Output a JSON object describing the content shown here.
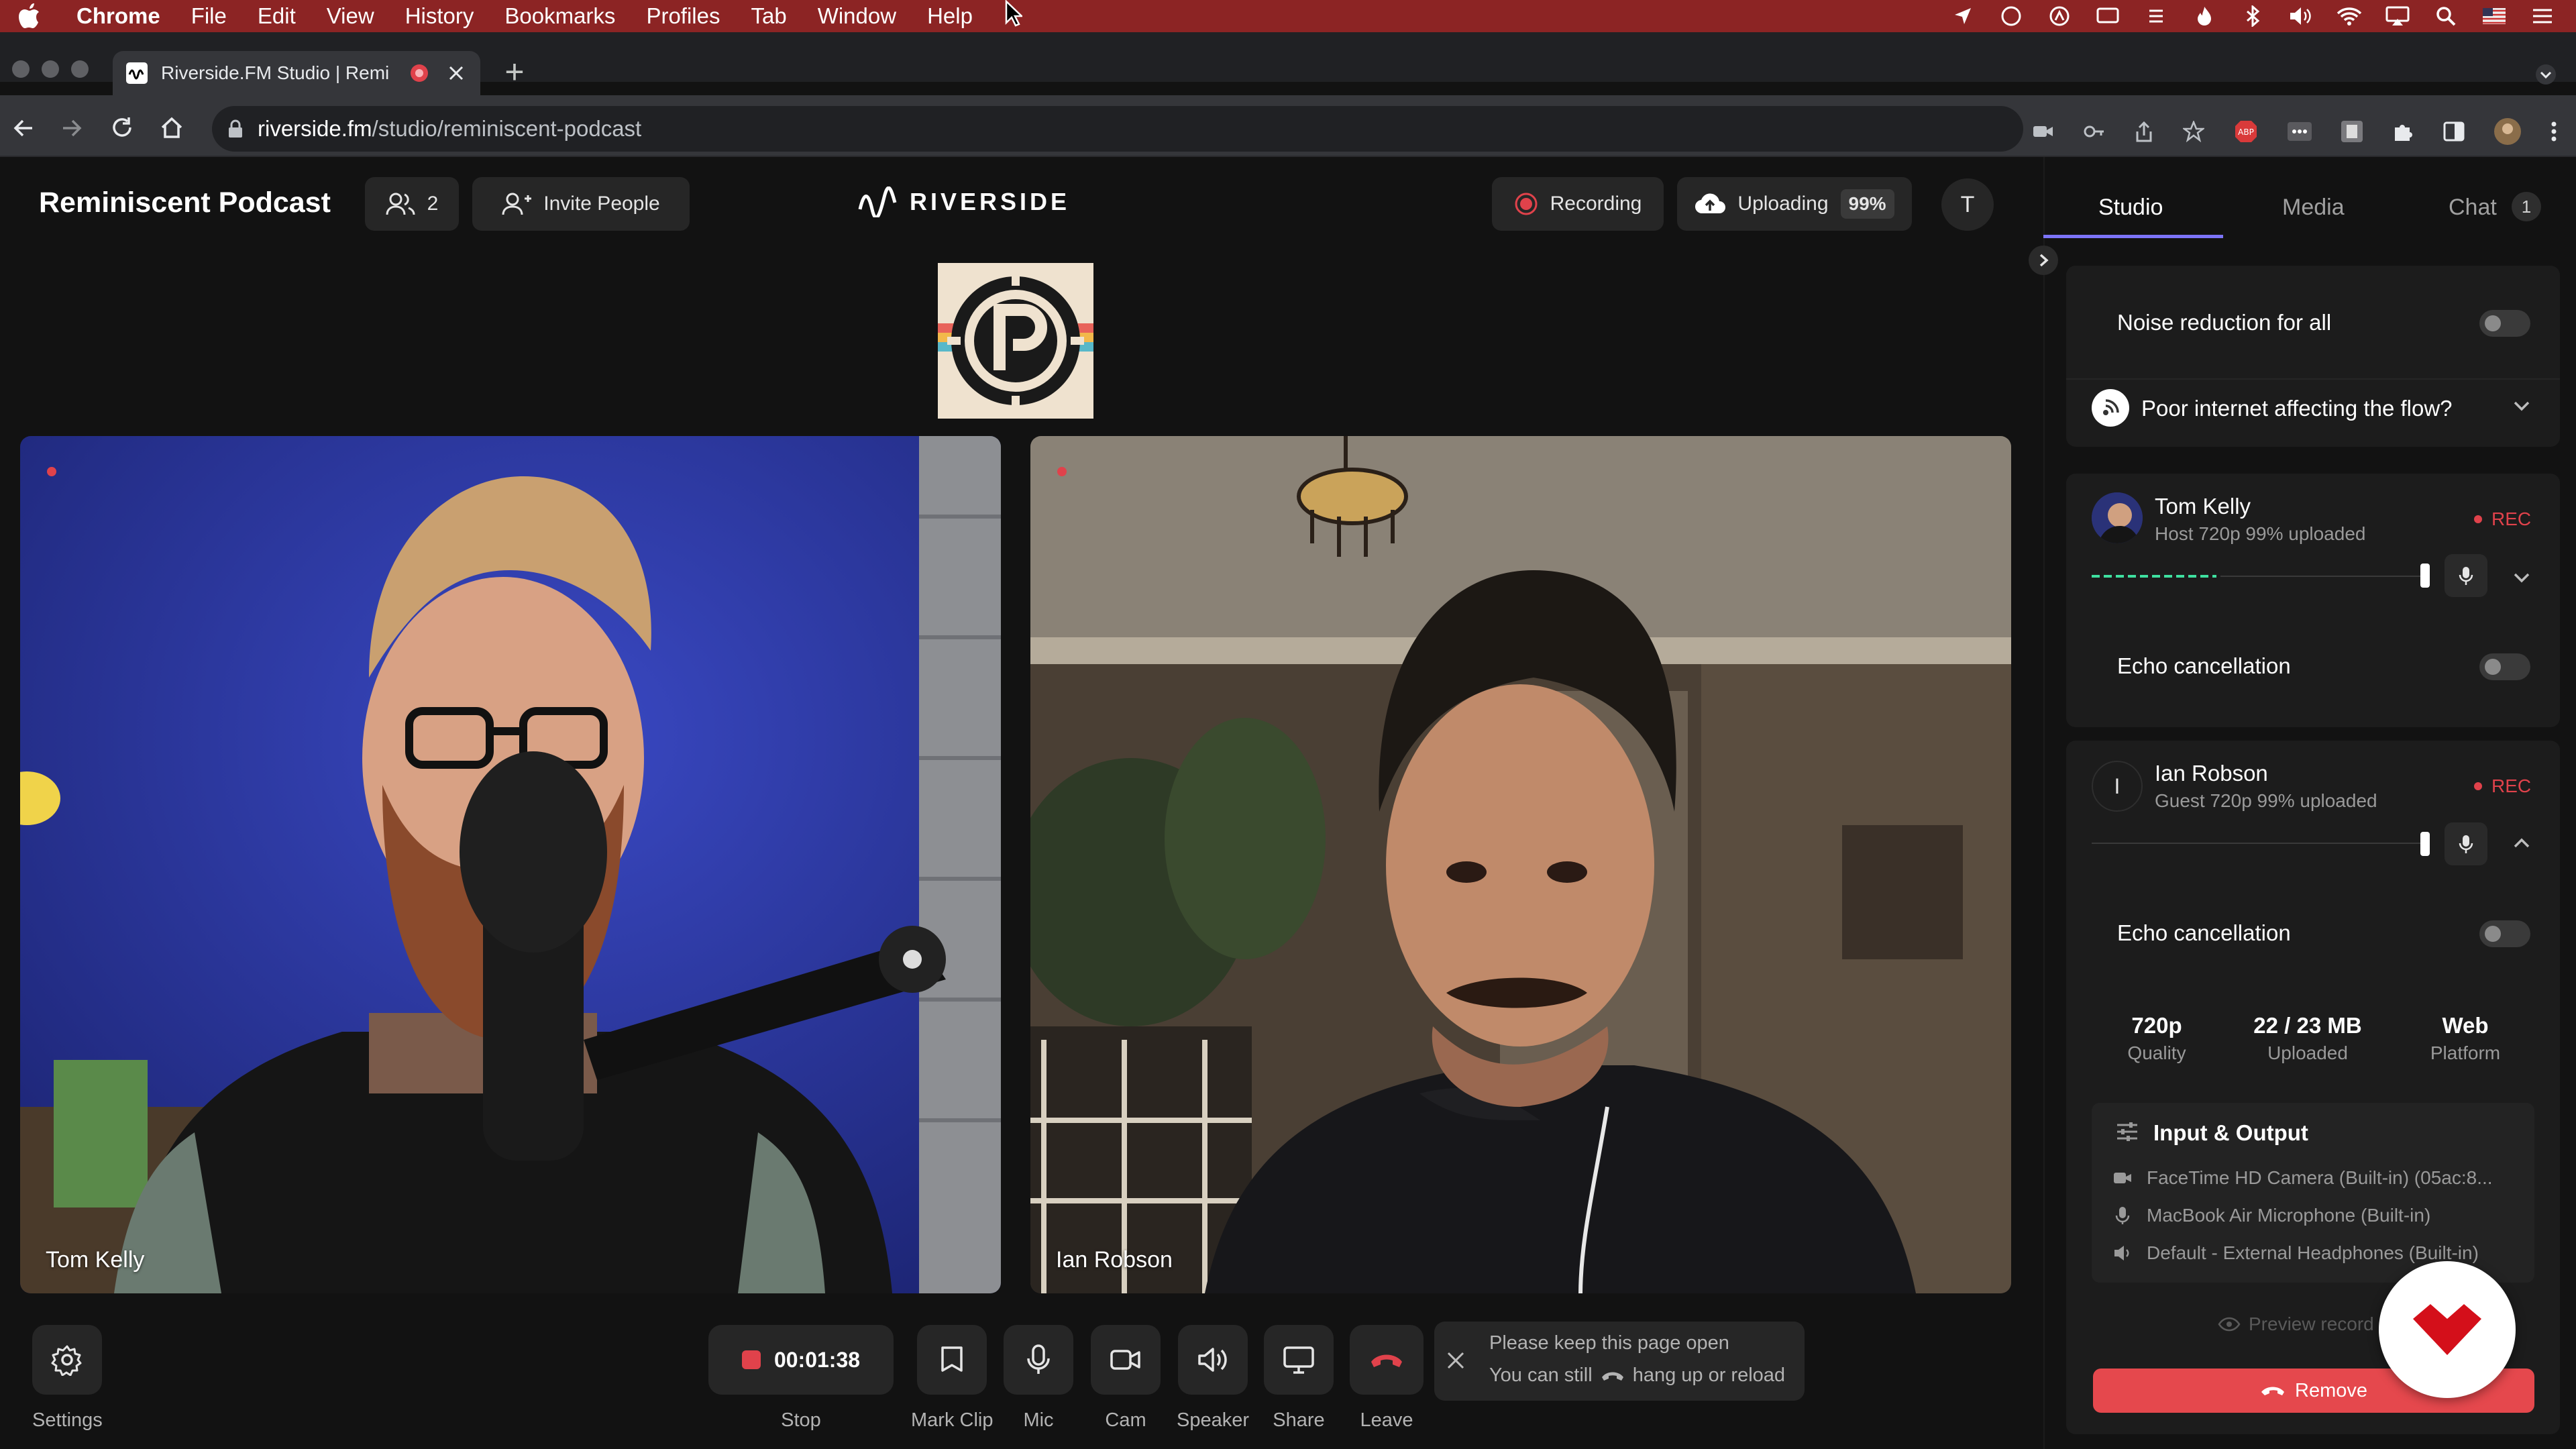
{
  "menubar": {
    "app": "Chrome",
    "items": [
      "File",
      "Edit",
      "View",
      "History",
      "Bookmarks",
      "Profiles",
      "Tab",
      "Window",
      "Help"
    ]
  },
  "browser": {
    "tab_title": "Riverside.FM Studio | Remi",
    "url_host": "riverside.fm",
    "url_path": "/studio/reminiscent-podcast"
  },
  "header": {
    "title": "Reminiscent Podcast",
    "participants_count": "2",
    "invite_label": "Invite People",
    "brand": "RIVERSIDE",
    "recording_label": "Recording",
    "uploading_label": "Uploading",
    "uploading_pct": "99%",
    "avatar_initial": "T"
  },
  "videos": [
    {
      "name": "Tom Kelly"
    },
    {
      "name": "Ian Robson"
    }
  ],
  "controls": {
    "settings": "Settings",
    "timer": "00:01:38",
    "stop": "Stop",
    "mark_clip": "Mark Clip",
    "mic": "Mic",
    "cam": "Cam",
    "speaker": "Speaker",
    "share": "Share",
    "leave": "Leave",
    "notice_line1": "Please keep this page open",
    "notice_line2_a": "You can still",
    "notice_line2_b": "hang up or reload"
  },
  "panel": {
    "tabs": [
      "Studio",
      "Media",
      "Chat"
    ],
    "chat_badge": "1",
    "noise_reduction": "Noise reduction for all",
    "poor_internet": "Poor internet affecting the flow?",
    "participants": [
      {
        "name": "Tom Kelly",
        "meta": "Host  720p  99% uploaded",
        "rec": "REC",
        "echo": "Echo cancellation"
      },
      {
        "name": "Ian Robson",
        "initial": "I",
        "meta": "Guest  720p  99% uploaded",
        "rec": "REC",
        "echo": "Echo cancellation"
      }
    ],
    "stats": [
      {
        "value": "720p",
        "label": "Quality"
      },
      {
        "value": "22 / 23 MB",
        "label": "Uploaded"
      },
      {
        "value": "Web",
        "label": "Platform"
      }
    ],
    "io_title": "Input & Output",
    "io": [
      "FaceTime HD Camera (Built-in) (05ac:8...",
      "MacBook Air Microphone (Built-in)",
      "Default - External Headphones (Built-in)"
    ],
    "preview": "Preview record",
    "remove": "Remove"
  },
  "colors": {
    "menubar": "#8c2424",
    "accent": "#7c74f8",
    "record_red": "#e0424b",
    "remove_button": "#e5484d"
  }
}
